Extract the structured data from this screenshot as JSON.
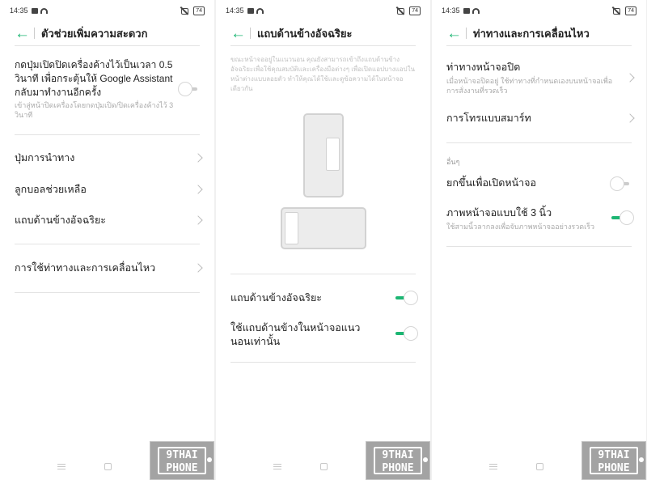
{
  "status": {
    "time": "14:35",
    "battery": "74"
  },
  "screen1": {
    "title": "ตัวช่วยเพิ่มความสะดวก",
    "power_button_text": "กดปุ่มเปิดปิดเครื่องค้างไว้เป็นเวลา 0.5 วินาที เพื่อกระตุ้นให้ Google Assistant กลับมาทำงานอีกครั้ง",
    "power_button_sub": "เข้าสู่หน้าปิดเครื่องโดยกดปุ่มเปิด/ปิดเครื่องค้างไว้ 3 วินาที",
    "items": [
      {
        "label": "ปุ่มการนำทาง"
      },
      {
        "label": "ลูกบอลช่วยเหลือ"
      },
      {
        "label": "แถบด้านข้างอัจฉริยะ"
      }
    ],
    "gestures_label": "การใช้ท่าทางและการเคลื่อนไหว"
  },
  "screen2": {
    "title": "แถบด้านข้างอัจฉริยะ",
    "description": "ขณะหน้าจออยู่ในแนวนอน คุณยังสามารถเข้าถึงแถบด้านข้างอัจฉริยะเพื่อใช้คุณสมบัติและเครื่องมือต่างๆ เพื่อเปิดแอปบางแอปในหน้าต่างแบบลอยตัว ทำให้คุณได้ใช้และดูข้อความได้ในหน้าจอเดียวกัน",
    "toggle1_label": "แถบด้านข้างอัจฉริยะ",
    "toggle2_label": "ใช้แถบด้านข้างในหน้าจอแนวนอนเท่านั้น"
  },
  "screen3": {
    "title": "ท่าทางและการเคลื่อนไหว",
    "gesture_off_label": "ท่าทางหน้าจอปิด",
    "gesture_off_sub": "เมื่อหน้าจอปิดอยู่ ใช้ท่าทางที่กำหนดเองบนหน้าจอเพื่อการสั่งงานที่รวดเร็ว",
    "smart_call_label": "การโทรแบบสมาร์ท",
    "others_label": "อื่นๆ",
    "raise_wake_label": "ยกขึ้นเพื่อเปิดหน้าจอ",
    "three_finger_label": "ภาพหน้าจอแบบใช้ 3 นิ้ว",
    "three_finger_sub": "ใช้สามนิ้วลากลงเพื่อจับภาพหน้าจออย่างรวดเร็ว"
  },
  "watermark": {
    "line1": "9THAI",
    "line2": "PHONE"
  },
  "toggles": {
    "s1_power": false,
    "s2_sidebar": true,
    "s2_landscape": true,
    "s3_raise": false,
    "s3_three_finger": true
  },
  "colors": {
    "accent": "#1cb673"
  }
}
